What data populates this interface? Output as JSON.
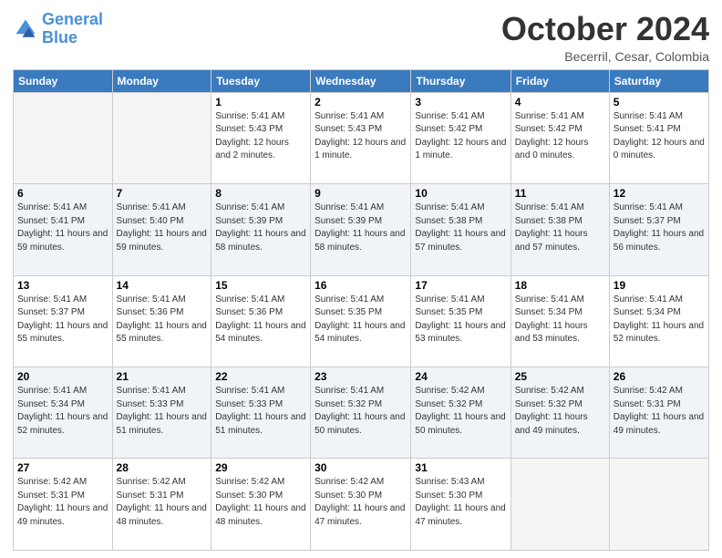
{
  "header": {
    "logo_general": "General",
    "logo_blue": "Blue",
    "month": "October 2024",
    "location": "Becerril, Cesar, Colombia"
  },
  "weekdays": [
    "Sunday",
    "Monday",
    "Tuesday",
    "Wednesday",
    "Thursday",
    "Friday",
    "Saturday"
  ],
  "rows": [
    [
      {
        "day": "",
        "info": ""
      },
      {
        "day": "",
        "info": ""
      },
      {
        "day": "1",
        "info": "Sunrise: 5:41 AM\nSunset: 5:43 PM\nDaylight: 12 hours and 2 minutes."
      },
      {
        "day": "2",
        "info": "Sunrise: 5:41 AM\nSunset: 5:43 PM\nDaylight: 12 hours and 1 minute."
      },
      {
        "day": "3",
        "info": "Sunrise: 5:41 AM\nSunset: 5:42 PM\nDaylight: 12 hours and 1 minute."
      },
      {
        "day": "4",
        "info": "Sunrise: 5:41 AM\nSunset: 5:42 PM\nDaylight: 12 hours and 0 minutes."
      },
      {
        "day": "5",
        "info": "Sunrise: 5:41 AM\nSunset: 5:41 PM\nDaylight: 12 hours and 0 minutes."
      }
    ],
    [
      {
        "day": "6",
        "info": "Sunrise: 5:41 AM\nSunset: 5:41 PM\nDaylight: 11 hours and 59 minutes."
      },
      {
        "day": "7",
        "info": "Sunrise: 5:41 AM\nSunset: 5:40 PM\nDaylight: 11 hours and 59 minutes."
      },
      {
        "day": "8",
        "info": "Sunrise: 5:41 AM\nSunset: 5:39 PM\nDaylight: 11 hours and 58 minutes."
      },
      {
        "day": "9",
        "info": "Sunrise: 5:41 AM\nSunset: 5:39 PM\nDaylight: 11 hours and 58 minutes."
      },
      {
        "day": "10",
        "info": "Sunrise: 5:41 AM\nSunset: 5:38 PM\nDaylight: 11 hours and 57 minutes."
      },
      {
        "day": "11",
        "info": "Sunrise: 5:41 AM\nSunset: 5:38 PM\nDaylight: 11 hours and 57 minutes."
      },
      {
        "day": "12",
        "info": "Sunrise: 5:41 AM\nSunset: 5:37 PM\nDaylight: 11 hours and 56 minutes."
      }
    ],
    [
      {
        "day": "13",
        "info": "Sunrise: 5:41 AM\nSunset: 5:37 PM\nDaylight: 11 hours and 55 minutes."
      },
      {
        "day": "14",
        "info": "Sunrise: 5:41 AM\nSunset: 5:36 PM\nDaylight: 11 hours and 55 minutes."
      },
      {
        "day": "15",
        "info": "Sunrise: 5:41 AM\nSunset: 5:36 PM\nDaylight: 11 hours and 54 minutes."
      },
      {
        "day": "16",
        "info": "Sunrise: 5:41 AM\nSunset: 5:35 PM\nDaylight: 11 hours and 54 minutes."
      },
      {
        "day": "17",
        "info": "Sunrise: 5:41 AM\nSunset: 5:35 PM\nDaylight: 11 hours and 53 minutes."
      },
      {
        "day": "18",
        "info": "Sunrise: 5:41 AM\nSunset: 5:34 PM\nDaylight: 11 hours and 53 minutes."
      },
      {
        "day": "19",
        "info": "Sunrise: 5:41 AM\nSunset: 5:34 PM\nDaylight: 11 hours and 52 minutes."
      }
    ],
    [
      {
        "day": "20",
        "info": "Sunrise: 5:41 AM\nSunset: 5:34 PM\nDaylight: 11 hours and 52 minutes."
      },
      {
        "day": "21",
        "info": "Sunrise: 5:41 AM\nSunset: 5:33 PM\nDaylight: 11 hours and 51 minutes."
      },
      {
        "day": "22",
        "info": "Sunrise: 5:41 AM\nSunset: 5:33 PM\nDaylight: 11 hours and 51 minutes."
      },
      {
        "day": "23",
        "info": "Sunrise: 5:41 AM\nSunset: 5:32 PM\nDaylight: 11 hours and 50 minutes."
      },
      {
        "day": "24",
        "info": "Sunrise: 5:42 AM\nSunset: 5:32 PM\nDaylight: 11 hours and 50 minutes."
      },
      {
        "day": "25",
        "info": "Sunrise: 5:42 AM\nSunset: 5:32 PM\nDaylight: 11 hours and 49 minutes."
      },
      {
        "day": "26",
        "info": "Sunrise: 5:42 AM\nSunset: 5:31 PM\nDaylight: 11 hours and 49 minutes."
      }
    ],
    [
      {
        "day": "27",
        "info": "Sunrise: 5:42 AM\nSunset: 5:31 PM\nDaylight: 11 hours and 49 minutes."
      },
      {
        "day": "28",
        "info": "Sunrise: 5:42 AM\nSunset: 5:31 PM\nDaylight: 11 hours and 48 minutes."
      },
      {
        "day": "29",
        "info": "Sunrise: 5:42 AM\nSunset: 5:30 PM\nDaylight: 11 hours and 48 minutes."
      },
      {
        "day": "30",
        "info": "Sunrise: 5:42 AM\nSunset: 5:30 PM\nDaylight: 11 hours and 47 minutes."
      },
      {
        "day": "31",
        "info": "Sunrise: 5:43 AM\nSunset: 5:30 PM\nDaylight: 11 hours and 47 minutes."
      },
      {
        "day": "",
        "info": ""
      },
      {
        "day": "",
        "info": ""
      }
    ]
  ]
}
